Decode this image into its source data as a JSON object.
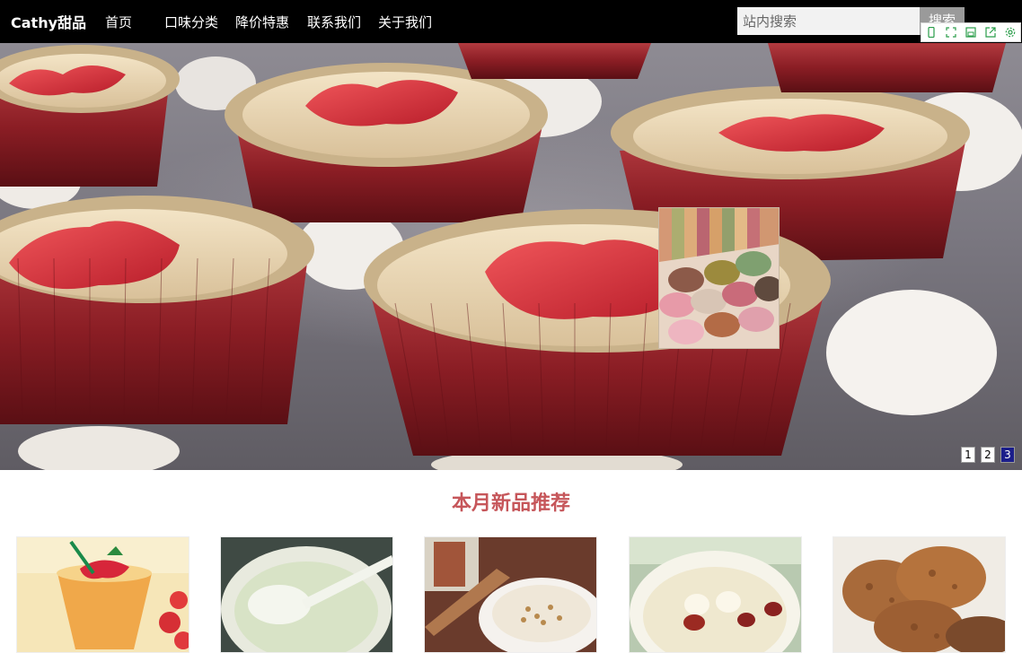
{
  "header": {
    "brand": "Cathy甜品",
    "nav": [
      "首页",
      "口味分类",
      "降价特惠",
      "联系我们",
      "关于我们"
    ],
    "search": {
      "placeholder": "站内搜索",
      "button_label": "搜索"
    }
  },
  "extension_toolbar": {
    "icons": [
      "mobile-icon",
      "expand-icon",
      "save-icon",
      "export-icon",
      "settings-icon"
    ]
  },
  "hero": {
    "pager": [
      "1",
      "2",
      "3"
    ],
    "active_page": "3"
  },
  "new_products": {
    "title": "本月新品推荐"
  },
  "colors": {
    "accent": "#c6565a",
    "pager_active": "#1b1e8a",
    "topbar": "#000000"
  }
}
